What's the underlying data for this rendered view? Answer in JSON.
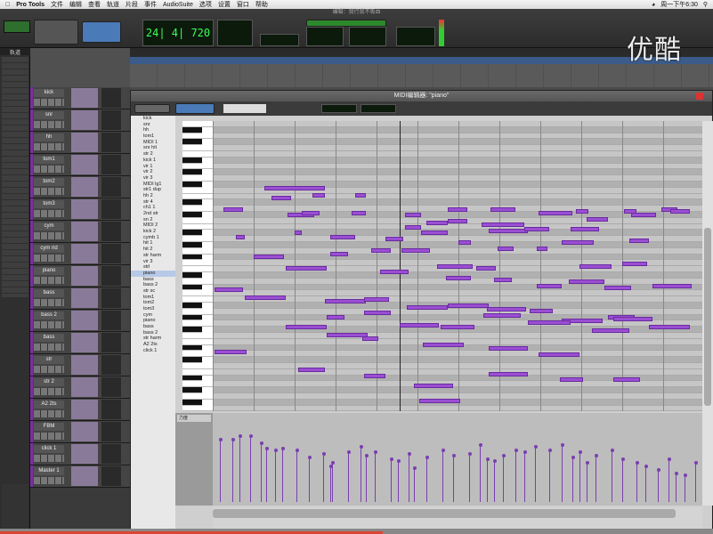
{
  "menubar": {
    "app": "Pro Tools",
    "items": [
      "文件",
      "编辑",
      "查看",
      "轨道",
      "片段",
      "事件",
      "AudioSuite",
      "选项",
      "设置",
      "窗口",
      "帮助"
    ],
    "clock": "周一下午6:30"
  },
  "toolbar": {
    "counter": "24| 4| 720",
    "window_title": "编辑：我行我不吸血"
  },
  "tracks": [
    {
      "name": "kick"
    },
    {
      "name": "snr"
    },
    {
      "name": "hh"
    },
    {
      "name": "tom1"
    },
    {
      "name": "tom2"
    },
    {
      "name": "tom3"
    },
    {
      "name": "cym"
    },
    {
      "name": "cym rid"
    },
    {
      "name": "piano"
    },
    {
      "name": "bass"
    },
    {
      "name": "bass 2"
    },
    {
      "name": "bass"
    },
    {
      "name": "str"
    },
    {
      "name": "str 2"
    },
    {
      "name": "A2 2ts"
    },
    {
      "name": "FBM"
    },
    {
      "name": "click 1"
    },
    {
      "name": "Master 1"
    }
  ],
  "midi": {
    "title": "MIDI编辑器: \"piano\"",
    "track_list": [
      "kick",
      "snr",
      "hh",
      "tom1",
      "MIDI 1",
      "snr hit",
      "str 2",
      "kick 1",
      "vir 1",
      "vir 2",
      "vir 3",
      "MIDI lg1",
      "str1 dup",
      "hh 2",
      "str 4",
      "ch1 1",
      "2nd str",
      "sn 2",
      "MIDI 2",
      "kick 2",
      "cymb 1",
      "hit 1",
      "hit 2",
      "str harm",
      "vir 3",
      "strl",
      "piano",
      "bass",
      "bass 2",
      "str sc",
      "tom1",
      "tom2",
      "tom3",
      "cym",
      "piano",
      "bass",
      "bass 2",
      "str harm",
      "A2 2ts",
      "click 1"
    ],
    "selected_track": "piano"
  },
  "watermark": "优酷",
  "colors": {
    "note": "#9a4fd2",
    "track_stripe": "#7a2fa0",
    "lcd": "#3cff5a"
  }
}
